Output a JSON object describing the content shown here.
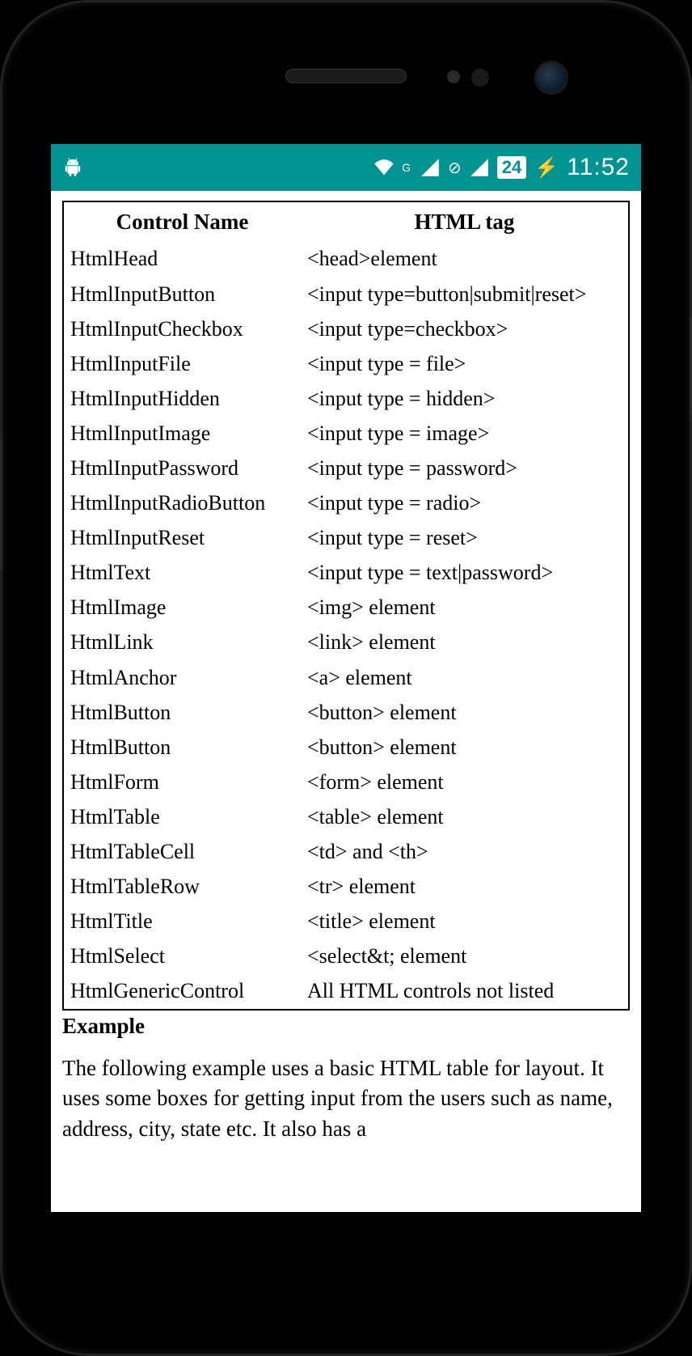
{
  "statusbar": {
    "battery_level": "24",
    "time": "11:52",
    "signal_label_1": "G",
    "no_sim_symbol": "⊘"
  },
  "table": {
    "header_col1": "Control Name",
    "header_col2": "HTML tag",
    "rows": [
      {
        "name": "HtmlHead",
        "tag": "<head>element"
      },
      {
        "name": "HtmlInputButton",
        "tag": "<input type=button|submit|reset>"
      },
      {
        "name": "HtmlInputCheckbox",
        "tag": "<input type=checkbox>"
      },
      {
        "name": "HtmlInputFile",
        "tag": "<input type = file>"
      },
      {
        "name": "HtmlInputHidden",
        "tag": "<input type = hidden>"
      },
      {
        "name": "HtmlInputImage",
        "tag": "<input type = image>"
      },
      {
        "name": "HtmlInputPassword",
        "tag": "<input type = password>"
      },
      {
        "name": "HtmlInputRadioButton",
        "tag": "<input type = radio>"
      },
      {
        "name": "HtmlInputReset",
        "tag": "<input type = reset>"
      },
      {
        "name": "HtmlText",
        "tag": "<input type = text|password>"
      },
      {
        "name": "HtmlImage",
        "tag": "<img> element"
      },
      {
        "name": "HtmlLink",
        "tag": "<link> element"
      },
      {
        "name": "HtmlAnchor",
        "tag": "<a> element"
      },
      {
        "name": "HtmlButton",
        "tag": "<button> element"
      },
      {
        "name": "HtmlButton",
        "tag": "<button> element"
      },
      {
        "name": "HtmlForm",
        "tag": "<form> element"
      },
      {
        "name": "HtmlTable",
        "tag": "<table> element"
      },
      {
        "name": "HtmlTableCell",
        "tag": "<td> and <th>"
      },
      {
        "name": "HtmlTableRow",
        "tag": "<tr> element"
      },
      {
        "name": "HtmlTitle",
        "tag": "<title> element"
      },
      {
        "name": "HtmlSelect",
        "tag": "<select&t; element"
      },
      {
        "name": "HtmlGenericControl",
        "tag": "All HTML controls not listed"
      }
    ]
  },
  "example": {
    "heading": "Example",
    "text": "The following example uses a basic HTML table for layout. It uses some boxes for getting input from the users such as name, address, city, state etc. It also has a"
  }
}
